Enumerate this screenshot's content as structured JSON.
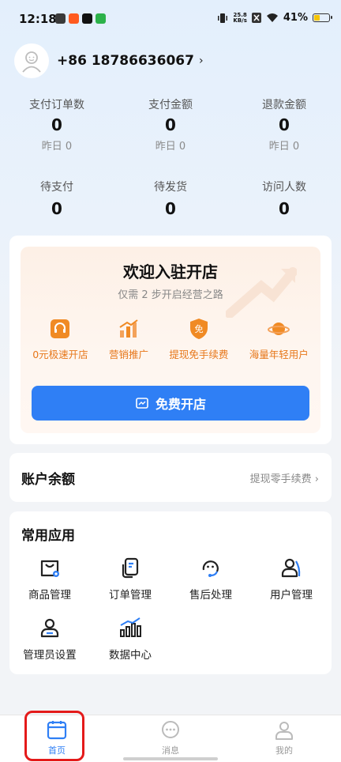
{
  "status_bar": {
    "time": "12:18",
    "net_speed_value": "25.8",
    "net_speed_unit": "KB/s",
    "battery": "41%"
  },
  "profile": {
    "phone": "+86 18786636067",
    "chevron": "›"
  },
  "stats": [
    {
      "label": "支付订单数",
      "value": "0",
      "sub": "昨日 0"
    },
    {
      "label": "支付金额",
      "value": "0",
      "sub": "昨日 0"
    },
    {
      "label": "退款金额",
      "value": "0",
      "sub": "昨日 0"
    },
    {
      "label": "待支付",
      "value": "0"
    },
    {
      "label": "待发货",
      "value": "0"
    },
    {
      "label": "访问人数",
      "value": "0"
    }
  ],
  "welcome": {
    "title": "欢迎入驻开店",
    "subtitle": "仅需 2 步开启经营之路",
    "features": [
      {
        "label": "0元极速开店",
        "icon": "headset-icon"
      },
      {
        "label": "营销推广",
        "icon": "chart-icon"
      },
      {
        "label": "提现免手续费",
        "icon": "free-badge-icon",
        "badge_text": "免"
      },
      {
        "label": "海量年轻用户",
        "icon": "planet-icon"
      }
    ],
    "button_label": "免费开店"
  },
  "balance": {
    "title": "账户余额",
    "link": "提现零手续费 ›"
  },
  "apps": {
    "title": "常用应用",
    "items": [
      {
        "label": "商品管理",
        "icon": "bag-icon"
      },
      {
        "label": "订单管理",
        "icon": "order-icon"
      },
      {
        "label": "售后处理",
        "icon": "service-icon"
      },
      {
        "label": "用户管理",
        "icon": "user-icon"
      },
      {
        "label": "管理员设置",
        "icon": "admin-icon"
      },
      {
        "label": "数据中心",
        "icon": "data-icon"
      }
    ]
  },
  "tabbar": {
    "items": [
      {
        "label": "首页",
        "icon": "home-icon",
        "active": true
      },
      {
        "label": "消息",
        "icon": "message-icon",
        "active": false
      },
      {
        "label": "我的",
        "icon": "profile-icon",
        "active": false
      }
    ]
  },
  "colors": {
    "primary": "#2f7ff5",
    "accent_orange": "#e7771a",
    "highlight_red": "#e41a1a"
  }
}
